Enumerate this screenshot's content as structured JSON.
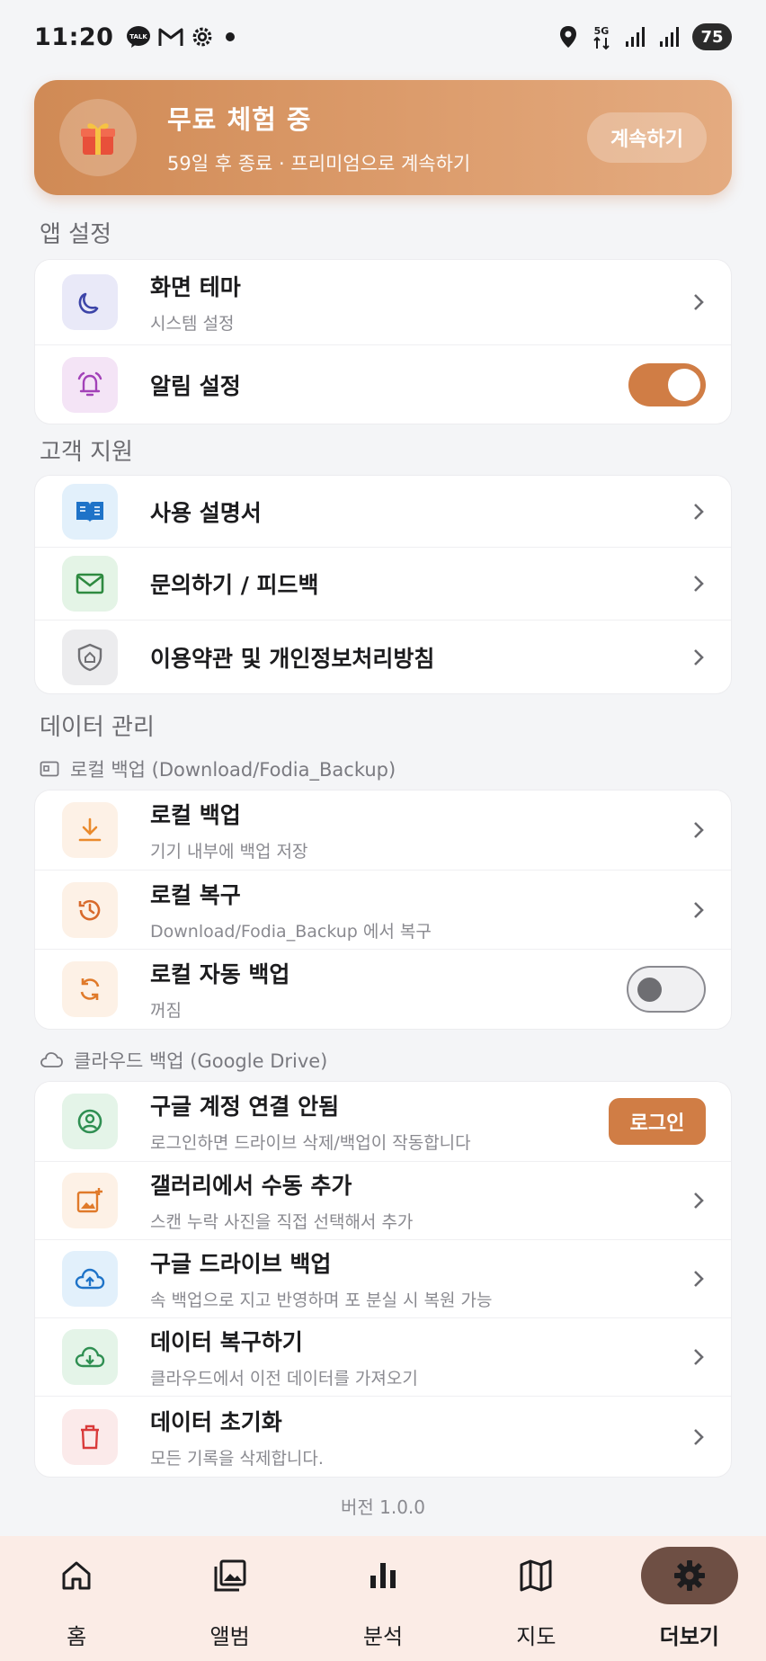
{
  "status_bar": {
    "time": "11:20",
    "battery": "75",
    "network": "5G"
  },
  "banner": {
    "title": "무료 체험 중",
    "subtitle": "59일 후 종료 · 프리미엄으로 계속하기",
    "button": "계속하기"
  },
  "sections": {
    "app_settings": "앱 설정",
    "support": "고객 지원",
    "data": "데이터 관리",
    "local_backup_label": "로컬 백업 (Download/Fodia_Backup)",
    "cloud_backup_label": "클라우드 백업 (Google Drive)"
  },
  "app_settings": {
    "theme": {
      "title": "화면 테마",
      "sub": "시스템 설정"
    },
    "notify": {
      "title": "알림 설정",
      "on": true
    }
  },
  "support": {
    "manual": "사용 설명서",
    "contact": "문의하기 / 피드백",
    "terms": "이용약관 및 개인정보처리방침"
  },
  "local": {
    "backup": {
      "title": "로컬 백업",
      "sub": "기기 내부에 백업 저장"
    },
    "restore": {
      "title": "로컬 복구",
      "sub": "Download/Fodia_Backup 에서 복구"
    },
    "auto": {
      "title": "로컬 자동 백업",
      "sub": "꺼짐",
      "on": false
    }
  },
  "cloud": {
    "account": {
      "title": "구글 계정 연결 안됨",
      "sub": "로그인하면 드라이브 삭제/백업이 작동합니다",
      "button": "로그인"
    },
    "gallery": {
      "title": "갤러리에서 수동 추가",
      "sub": "스캔 누락 사진을 직접 선택해서 추가"
    },
    "drive": {
      "title": "구글 드라이브 백업",
      "sub": "속 백업으로 지고 반영하며 포 분실 시 복원 가능"
    },
    "restore": {
      "title": "데이터 복구하기",
      "sub": "클라우드에서 이전 데이터를 가져오기"
    },
    "reset": {
      "title": "데이터 초기화",
      "sub": "모든 기록을 삭제합니다."
    }
  },
  "version": "버전 1.0.0",
  "nav": [
    "홈",
    "앨범",
    "분석",
    "지도",
    "더보기"
  ],
  "colors": {
    "accent": "#d07d45",
    "nav_active": "#6e4f44",
    "nav_bg": "#fbece6"
  }
}
